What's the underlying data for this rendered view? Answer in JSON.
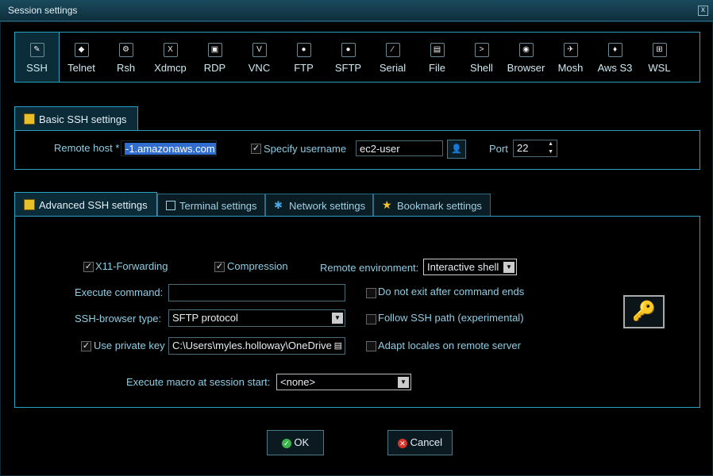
{
  "window": {
    "title": "Session settings",
    "close": "x"
  },
  "protocols": [
    {
      "label": "SSH",
      "icon": "ssh-icon",
      "glyph": "✎"
    },
    {
      "label": "Telnet",
      "icon": "telnet-icon",
      "glyph": "◆"
    },
    {
      "label": "Rsh",
      "icon": "rsh-icon",
      "glyph": "⚙"
    },
    {
      "label": "Xdmcp",
      "icon": "xdmcp-icon",
      "glyph": "X"
    },
    {
      "label": "RDP",
      "icon": "rdp-icon",
      "glyph": "▣"
    },
    {
      "label": "VNC",
      "icon": "vnc-icon",
      "glyph": "V"
    },
    {
      "label": "FTP",
      "icon": "ftp-icon",
      "glyph": "●"
    },
    {
      "label": "SFTP",
      "icon": "sftp-icon",
      "glyph": "●"
    },
    {
      "label": "Serial",
      "icon": "serial-icon",
      "glyph": "∕"
    },
    {
      "label": "File",
      "icon": "file-icon",
      "glyph": "▤"
    },
    {
      "label": "Shell",
      "icon": "shell-icon",
      "glyph": ">"
    },
    {
      "label": "Browser",
      "icon": "browser-icon",
      "glyph": "◉"
    },
    {
      "label": "Mosh",
      "icon": "mosh-icon",
      "glyph": "✈"
    },
    {
      "label": "Aws S3",
      "icon": "aws-s3-icon",
      "glyph": "♦"
    },
    {
      "label": "WSL",
      "icon": "wsl-icon",
      "glyph": "⊞"
    }
  ],
  "basic": {
    "tab_label": "Basic SSH settings",
    "remote_host_label": "Remote host *",
    "remote_host_value": "-1.amazonaws.com",
    "specify_username_label": "Specify username",
    "username_value": "ec2-user",
    "port_label": "Port",
    "port_value": "22"
  },
  "tabs": {
    "advanced": "Advanced SSH settings",
    "terminal": "Terminal settings",
    "network": "Network settings",
    "bookmark": "Bookmark settings"
  },
  "advanced": {
    "x11_label": "X11-Forwarding",
    "compression_label": "Compression",
    "remote_env_label": "Remote environment:",
    "remote_env_value": "Interactive shell",
    "execute_cmd_label": "Execute command:",
    "execute_cmd_value": "",
    "no_exit_label": "Do not exit after command ends",
    "browser_type_label": "SSH-browser type:",
    "browser_type_value": "SFTP protocol",
    "follow_path_label": "Follow SSH path (experimental)",
    "private_key_label": "Use private key",
    "private_key_value": "C:\\Users\\myles.holloway\\OneDrive",
    "adapt_locales_label": "Adapt locales on remote server",
    "macro_label": "Execute macro at session start:",
    "macro_value": "<none>"
  },
  "buttons": {
    "ok": "OK",
    "cancel": "Cancel"
  },
  "colors": {
    "accent": "#2aa0c3",
    "label": "#8ecde3",
    "tab_bg": "#0c2b38"
  }
}
